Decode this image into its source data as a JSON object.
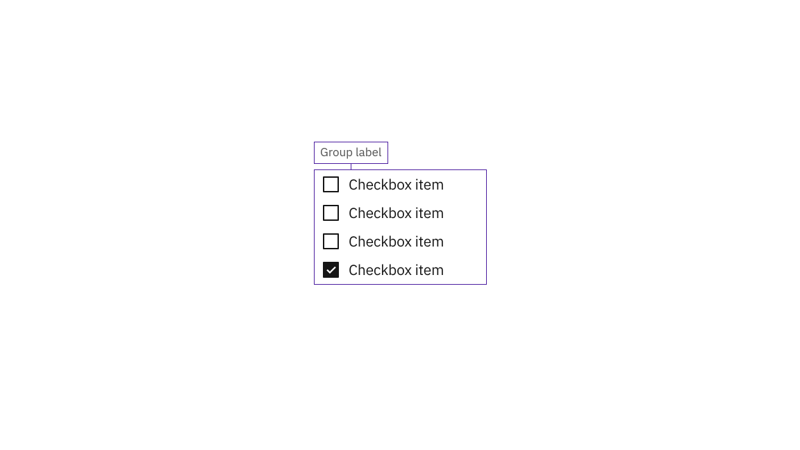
{
  "group": {
    "label": "Group label",
    "items": [
      {
        "label": "Checkbox item",
        "checked": false
      },
      {
        "label": "Checkbox item",
        "checked": false
      },
      {
        "label": "Checkbox item",
        "checked": false
      },
      {
        "label": "Checkbox item",
        "checked": true
      }
    ]
  },
  "colors": {
    "outline": "#4c1ea0",
    "text_primary": "#161616",
    "text_secondary": "#525252"
  }
}
